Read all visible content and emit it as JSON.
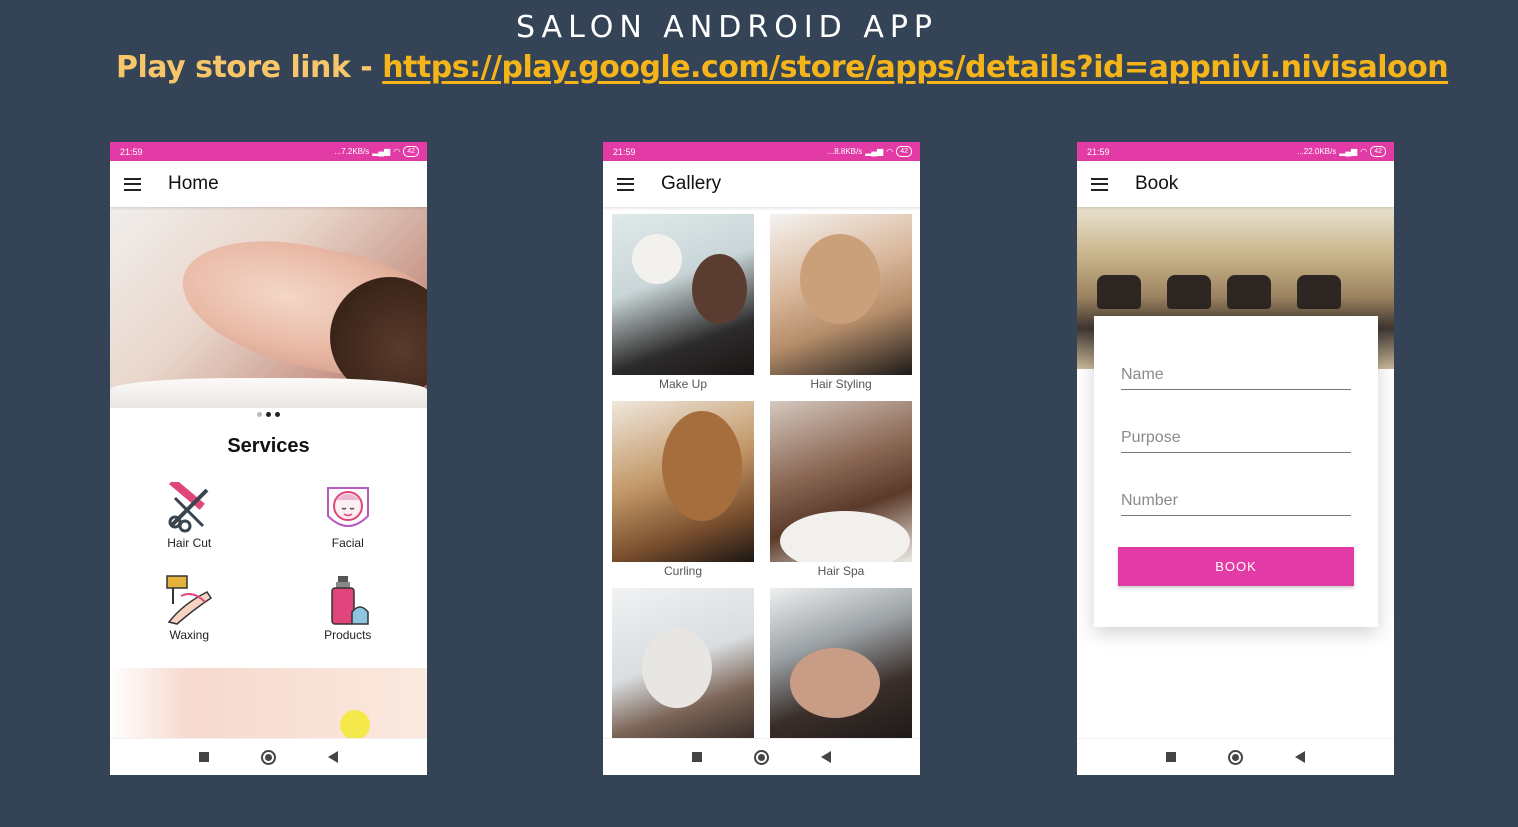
{
  "header": {
    "title": "SALON ANDROID APP",
    "play_label": "Play store link - ",
    "play_url": "https://play.google.com/store/apps/details?id=appnivi.nivisaloon"
  },
  "colors": {
    "background": "#344456",
    "accent": "#e33ba6",
    "link": "#f5b51a"
  },
  "screens": {
    "home": {
      "status": {
        "time": "21:59",
        "speed": "...7.2KB/s",
        "battery": "42"
      },
      "appbar_title": "Home",
      "services_title": "Services",
      "services": [
        {
          "label": "Hair Cut",
          "icon": "scissors-comb-icon"
        },
        {
          "label": "Facial",
          "icon": "facial-mask-icon"
        },
        {
          "label": "Waxing",
          "icon": "waxing-icon"
        },
        {
          "label": "Products",
          "icon": "spray-bottle-icon"
        }
      ],
      "carousel_page": 2,
      "carousel_count": 3
    },
    "gallery": {
      "status": {
        "time": "21:59",
        "speed": "...8.8KB/s",
        "battery": "42"
      },
      "appbar_title": "Gallery",
      "items": [
        "Make Up",
        "Hair Styling",
        "Curling",
        "Hair Spa",
        "",
        ""
      ]
    },
    "book": {
      "status": {
        "time": "21:59",
        "speed": "...22.0KB/s",
        "battery": "42"
      },
      "appbar_title": "Book",
      "fields": [
        {
          "placeholder": "Name",
          "value": ""
        },
        {
          "placeholder": "Purpose",
          "value": ""
        },
        {
          "placeholder": "Number",
          "value": ""
        }
      ],
      "button_label": "BOOK"
    }
  }
}
